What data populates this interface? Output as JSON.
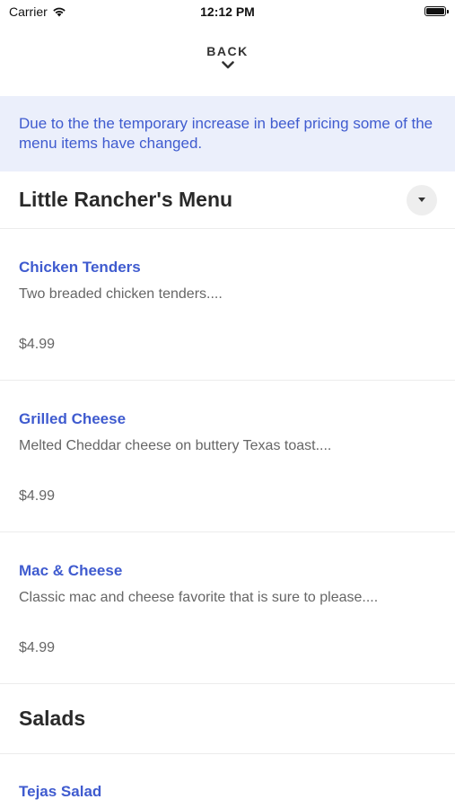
{
  "status_bar": {
    "carrier": "Carrier",
    "time": "12:12 PM"
  },
  "nav": {
    "back_label": "BACK"
  },
  "notice": {
    "text": "Due to the the temporary increase in beef pricing some of the menu items have changed."
  },
  "sections": [
    {
      "title": "Little Rancher's Menu",
      "items": [
        {
          "name": "Chicken Tenders",
          "description": "Two breaded chicken tenders....",
          "price": "$4.99"
        },
        {
          "name": "Grilled Cheese",
          "description": "Melted Cheddar cheese on buttery Texas toast....",
          "price": "$4.99"
        },
        {
          "name": "Mac & Cheese",
          "description": "Classic mac and cheese favorite that is sure to please....",
          "price": "$4.99"
        }
      ]
    },
    {
      "title": "Salads",
      "items": [
        {
          "name": "Tejas Salad"
        }
      ]
    }
  ],
  "colors": {
    "accent": "#3f5bcf",
    "notice_bg": "#ebeffb",
    "divider": "#ececec"
  },
  "icons": {
    "wifi": "wifi-icon",
    "battery": "battery-icon",
    "back": "chevron-down-icon",
    "dropdown": "caret-down-icon"
  }
}
